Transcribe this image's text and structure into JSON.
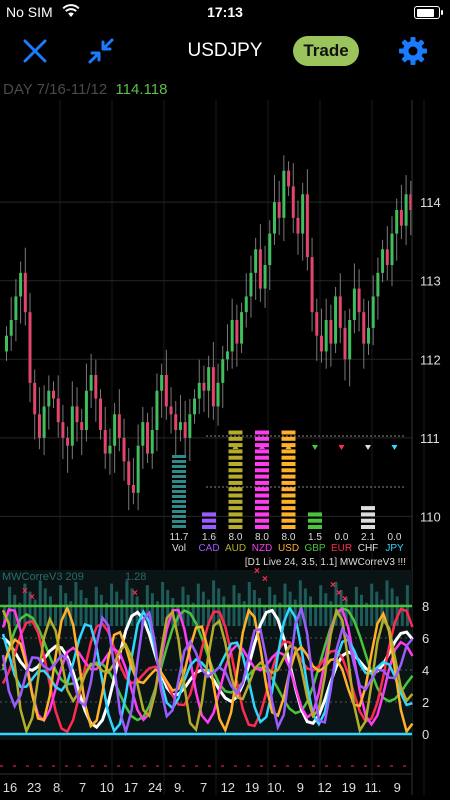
{
  "status_bar": {
    "carrier": "No SIM",
    "time": "17:13",
    "battery_level": 0.9
  },
  "toolbar": {
    "close_icon": "x-icon",
    "collapse_icon": "arrows-collapse-icon",
    "symbol": "USDJPY",
    "trade_label": "Trade",
    "settings_icon": "gear-icon"
  },
  "chart_info": {
    "period": "DAY 7/16-11/12",
    "last_price": "114.118"
  },
  "colors": {
    "accent": "#1a7bff",
    "trade_bg": "#9bc45d",
    "bull": "#3fbf5c",
    "bear": "#e2466c",
    "price_up": "#5dbe4a"
  },
  "chart_data": [
    {
      "type": "candlestick",
      "title": "USDJPY",
      "ylim": [
        109.7,
        115.3
      ],
      "y_ticks": [
        "114",
        "113",
        "112",
        "111",
        "110"
      ],
      "x_ticks": [
        "16",
        "23",
        "8.",
        "7",
        "10",
        "17",
        "24",
        "9.",
        "7",
        "12",
        "19",
        "10.",
        "9",
        "12",
        "19",
        "11.",
        "9"
      ],
      "closes": [
        112.3,
        112.5,
        112.8,
        113.1,
        112.6,
        111.7,
        111.3,
        111.0,
        111.4,
        111.6,
        111.5,
        111.2,
        111.0,
        110.9,
        111.4,
        111.2,
        111.1,
        111.6,
        111.8,
        111.5,
        111.1,
        110.8,
        110.9,
        111.3,
        111.0,
        110.7,
        110.4,
        110.3,
        110.9,
        111.2,
        110.8,
        111.1,
        111.6,
        111.8,
        111.4,
        111.3,
        111.1,
        111.2,
        111.0,
        111.3,
        111.5,
        111.7,
        111.6,
        111.9,
        111.4,
        111.7,
        112.0,
        112.1,
        112.5,
        112.2,
        112.6,
        112.8,
        113.1,
        113.4,
        112.9,
        113.2,
        113.6,
        114.0,
        113.8,
        114.4,
        114.2,
        113.8,
        113.6,
        114.1,
        113.3,
        112.6,
        112.3,
        112.1,
        112.5,
        112.2,
        112.8,
        112.4,
        112.0,
        112.5,
        112.9,
        112.6,
        112.2,
        112.4,
        112.8,
        113.1,
        113.4,
        113.2,
        113.6,
        113.9,
        113.7,
        114.1,
        113.9
      ],
      "meter": {
        "vol": "11.7",
        "currencies": [
          {
            "name": "CAD",
            "value": "1.6",
            "color": "#9b5cff"
          },
          {
            "name": "AUD",
            "value": "8.0",
            "color": "#b5ad2a"
          },
          {
            "name": "NZD",
            "value": "8.0",
            "color": "#ff3cf0"
          },
          {
            "name": "USD",
            "value": "8.0",
            "color": "#ffb12a"
          },
          {
            "name": "GBP",
            "value": "1.5",
            "color": "#48c53a"
          },
          {
            "name": "EUR",
            "value": "0.0",
            "color": "#ff2b51"
          },
          {
            "name": "CHF",
            "value": "2.1",
            "color": "#dddddd"
          },
          {
            "name": "JPY",
            "value": "0.0",
            "color": "#2fd6ff"
          }
        ],
        "vol_label": "Vol",
        "footer": "[D1 Live 24, 3.5, 1.1] MWCorreV3 !!!"
      }
    },
    {
      "type": "line",
      "title": "MWCorreV3 209",
      "subtitle": "1.28",
      "ylim": [
        0,
        8
      ],
      "y_ticks": [
        "8",
        "6",
        "4",
        "2",
        "0"
      ]
    }
  ]
}
